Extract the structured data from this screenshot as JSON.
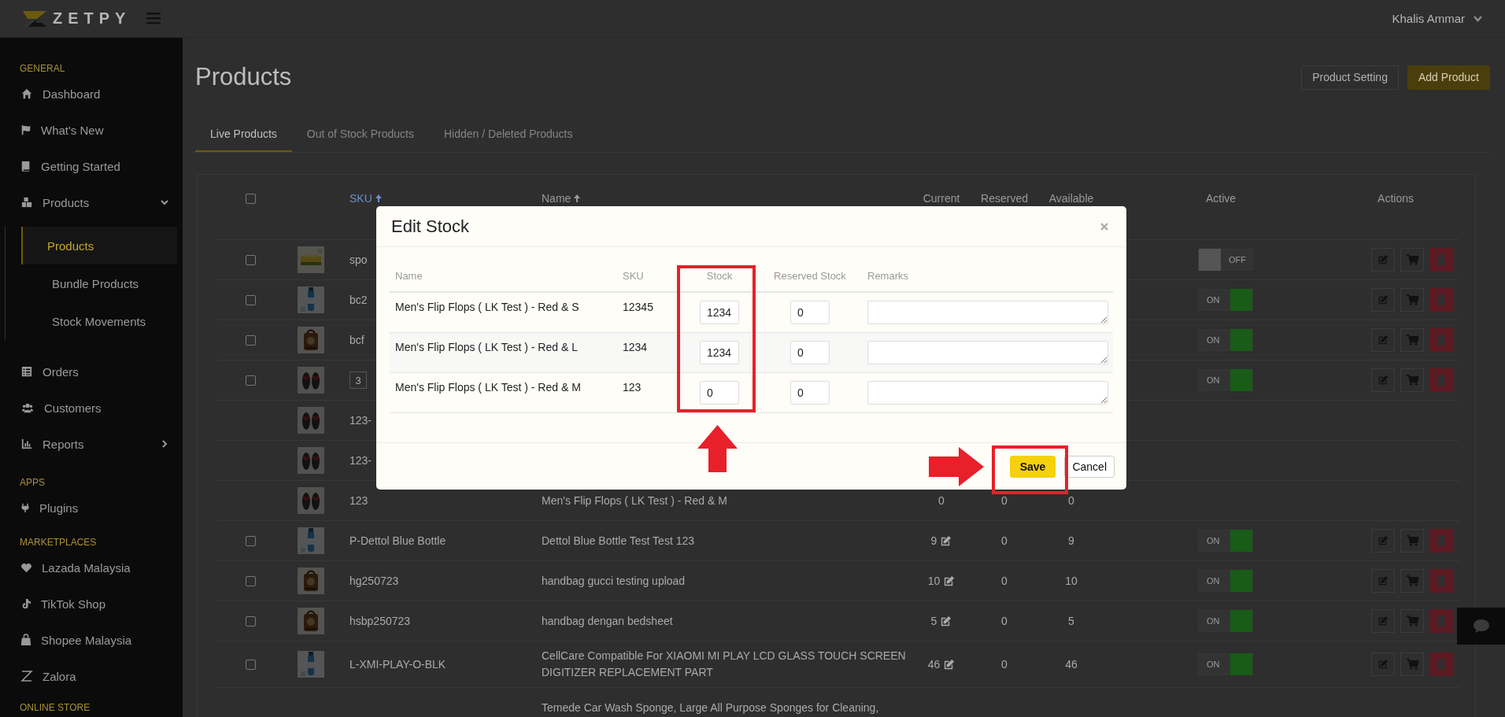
{
  "header": {
    "brand": "ZETPY",
    "user": "Khalis Ammar"
  },
  "sidebar": {
    "sections": [
      {
        "label": "GENERAL",
        "items": [
          {
            "label": "Dashboard"
          },
          {
            "label": "What's New"
          },
          {
            "label": "Getting Started"
          },
          {
            "label": "Products",
            "expanded": true,
            "children": [
              {
                "label": "Products",
                "selected": true
              },
              {
                "label": "Bundle Products",
                "selected": false
              },
              {
                "label": "Stock Movements",
                "selected": false
              }
            ]
          },
          {
            "label": "Orders"
          },
          {
            "label": "Customers"
          },
          {
            "label": "Reports",
            "expanded": false
          }
        ]
      },
      {
        "label": "APPS",
        "items": [
          {
            "label": "Plugins"
          }
        ]
      },
      {
        "label": "MARKETPLACES",
        "items": [
          {
            "label": "Lazada Malaysia"
          },
          {
            "label": "TikTok Shop"
          },
          {
            "label": "Shopee Malaysia"
          },
          {
            "label": "Zalora"
          }
        ]
      },
      {
        "label": "ONLINE STORE"
      }
    ]
  },
  "page": {
    "title": "Products",
    "buttons": [
      {
        "label": "Product Setting",
        "kind": "secondary"
      },
      {
        "label": "Add Product",
        "kind": "primary"
      }
    ]
  },
  "tabs": [
    {
      "label": "Live Products",
      "selected": true
    },
    {
      "label": "Out of Stock Products",
      "selected": false
    },
    {
      "label": "Hidden / Deleted Products",
      "selected": false
    }
  ],
  "table": {
    "select_all": {
      "checked": false
    },
    "columns": [
      {
        "label": "SKU",
        "sortable": true
      },
      {
        "label": "Name",
        "sortable": true
      },
      {
        "label": "Current"
      },
      {
        "label": "Reserved"
      },
      {
        "label": "Available"
      },
      {
        "label": "Active"
      },
      {
        "label": "Actions"
      }
    ],
    "rows": [
      {
        "checked": false,
        "sku": "spo",
        "active": {
          "label": "OFF",
          "on": false
        },
        "actions": true
      },
      {
        "checked": false,
        "sku": "bc2",
        "active": {
          "label": "ON",
          "on": true
        },
        "actions": true
      },
      {
        "checked": false,
        "sku": "bcf",
        "active": {
          "label": "ON",
          "on": true
        },
        "actions": true
      },
      {
        "checked": false,
        "field_value": "3",
        "active": {
          "label": "ON",
          "on": true
        },
        "actions": true
      },
      {
        "sku": "123-"
      },
      {
        "sku": "123-"
      },
      {
        "sku": "123",
        "name": "Men's Flip Flops ( LK Test ) - Red & M",
        "current": "0",
        "reserved": "0",
        "available": "0"
      },
      {
        "checked": false,
        "sku": "P-Dettol Blue Bottle",
        "name": "Dettol Blue Bottle Test Test 123",
        "current": "9",
        "editable": true,
        "reserved": "0",
        "available": "9",
        "active": {
          "label": "ON",
          "on": true
        },
        "actions": true
      },
      {
        "checked": false,
        "sku": "hg250723",
        "name": "handbag gucci testing upload",
        "current": "10",
        "editable": true,
        "reserved": "0",
        "available": "10",
        "active": {
          "label": "ON",
          "on": true
        },
        "actions": true
      },
      {
        "checked": false,
        "sku": "hsbp250723",
        "name": "handbag dengan bedsheet",
        "current": "5",
        "editable": true,
        "reserved": "0",
        "available": "5",
        "active": {
          "label": "ON",
          "on": true
        },
        "actions": true
      },
      {
        "checked": false,
        "sku": "L-XMI-PLAY-O-BLK",
        "name": "CellCare Compatible For XIAOMI MI PLAY LCD GLASS TOUCH SCREEN DIGITIZER REPLACEMENT PART",
        "current": "46",
        "editable": true,
        "reserved": "0",
        "available": "46",
        "active": {
          "label": "ON",
          "on": true
        },
        "actions": true
      },
      {
        "name": "Temede Car Wash Sponge, Large All Purpose Sponges for Cleaning,"
      }
    ]
  },
  "modal": {
    "title": "Edit Stock",
    "columns": [
      "Name",
      "SKU",
      "Stock",
      "Reserved Stock",
      "Remarks"
    ],
    "rows": [
      {
        "name": "Men's Flip Flops ( LK Test ) - Red & S",
        "sku": "12345",
        "stock": "1234",
        "reserved": "0"
      },
      {
        "name": "Men's Flip Flops ( LK Test ) - Red & L",
        "sku": "1234",
        "stock": "1234",
        "reserved": "0"
      },
      {
        "name": "Men's Flip Flops ( LK Test ) - Red & M",
        "sku": "123",
        "stock": "0",
        "reserved": "0"
      }
    ],
    "buttons": [
      {
        "label": "Save",
        "kind": "primary"
      },
      {
        "label": "Cancel",
        "kind": "secondary"
      }
    ]
  },
  "annotations": [
    {
      "kind": "frame"
    },
    {
      "kind": "up-arrow"
    },
    {
      "kind": "right-arrow"
    },
    {
      "kind": "frame"
    }
  ]
}
